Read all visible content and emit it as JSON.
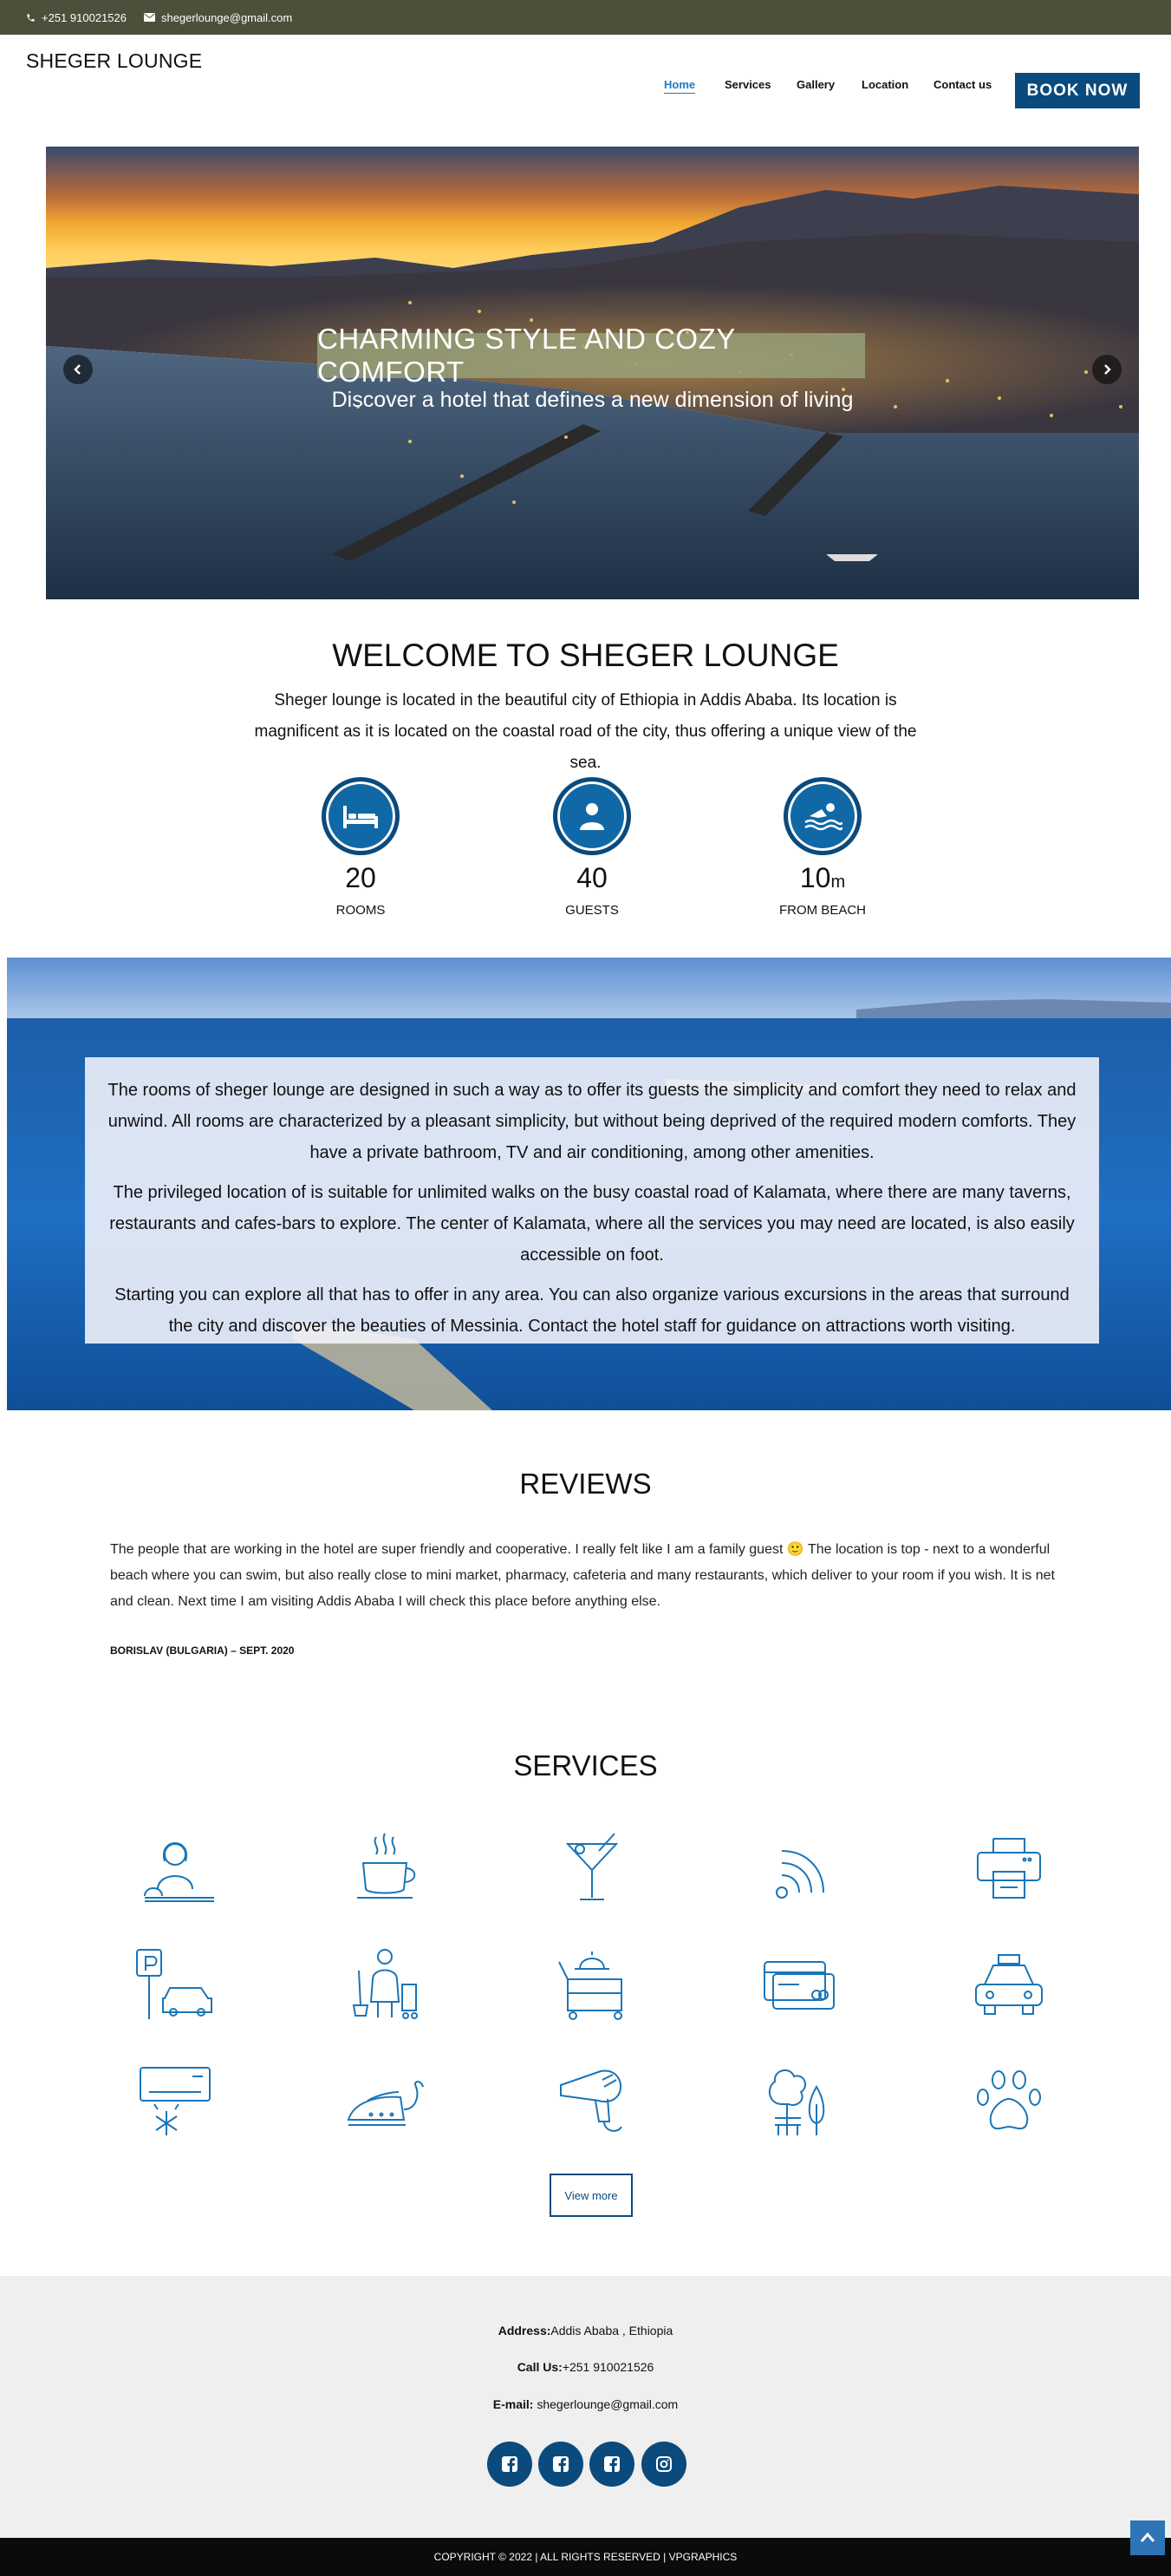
{
  "topbar": {
    "phone": "+251 910021526",
    "email": "shegerlounge@gmail.com",
    "color": "#4d4f3a"
  },
  "header": {
    "logo": "SHEGER LOUNGE",
    "nav": [
      "Home",
      "Services",
      "Gallery",
      "Location",
      "Contact us"
    ],
    "active": "Home",
    "book_now": "BOOK NOW",
    "accent": "#0b4a7c"
  },
  "hero": {
    "title": "CHARMING STYLE AND COZY COMFORT",
    "subtitle": "Discover a hotel that defines a new dimension of living"
  },
  "welcome": {
    "title": "WELCOME TO SHEGER LOUNGE",
    "text": "Sheger lounge is located in the beautiful city of Ethiopia in Addis Ababa. Its location is magnificent as it is located on the coastal road of the city, thus offering a unique view of the sea.",
    "stats": [
      {
        "value": "20",
        "unit": "",
        "label": "ROOMS",
        "icon": "bed-icon"
      },
      {
        "value": "40",
        "unit": "",
        "label": "GUESTS",
        "icon": "guest-icon"
      },
      {
        "value": "10",
        "unit": "m",
        "label": "FROM BEACH",
        "icon": "swimmer-icon"
      }
    ]
  },
  "about": {
    "paragraphs": [
      "The rooms of sheger lounge are designed in such a way as to offer its guests the simplicity and comfort they need to relax and unwind. All rooms are characterized by a pleasant simplicity, but without being deprived of the required modern comforts. They have a private bathroom, TV and air conditioning, among other amenities.",
      "The privileged location of is suitable for unlimited walks on the busy coastal road of Kalamata, where there are many taverns, restaurants and cafes-bars to explore. The center of Kalamata, where all the services you may need are located, is also easily accessible on foot.",
      "Starting you can explore all that has to offer in any area. You can also organize various excursions in the areas that surround the city and discover the beauties of Messinia. Contact the hotel staff for guidance on attractions worth visiting."
    ]
  },
  "reviews": {
    "title": "REVIEWS",
    "text": "The people that are working in the hotel are super friendly and cooperative. I really felt like I am a family guest 🙂 The location is top - next to a wonderful beach where you can swim, but also really close to mini market, pharmacy, cafeteria and many restaurants, which deliver to your room if you wish. It is net and clean. Next time I am visiting Addis Ababa I will check this place before anything else.",
    "author": "BORISLAV (BULGARIA) – SEPT. 2020"
  },
  "services": {
    "title": "SERVICES",
    "icons": [
      "reception-icon",
      "coffee-icon",
      "cocktail-icon",
      "wifi-icon",
      "printer-icon",
      "parking-icon",
      "housekeeping-icon",
      "room-service-icon",
      "credit-card-icon",
      "taxi-icon",
      "air-conditioning-icon",
      "iron-icon",
      "hair-dryer-icon",
      "garden-icon",
      "pet-icon"
    ],
    "view_more": "View more"
  },
  "footer": {
    "address_label": "Address:",
    "address": "Addis Ababa , Ethiopia",
    "call_label": "Call Us:",
    "call": "+251 910021526",
    "email_label": "E-mail:",
    "email": "shegerlounge@gmail.com",
    "social": [
      "facebook-icon",
      "facebook-icon",
      "facebook-icon",
      "instagram-icon"
    ],
    "copyright": "COPYRIGHT © 2022 | ALL RIGHTS RESERVED | VPGRAPHICS"
  }
}
